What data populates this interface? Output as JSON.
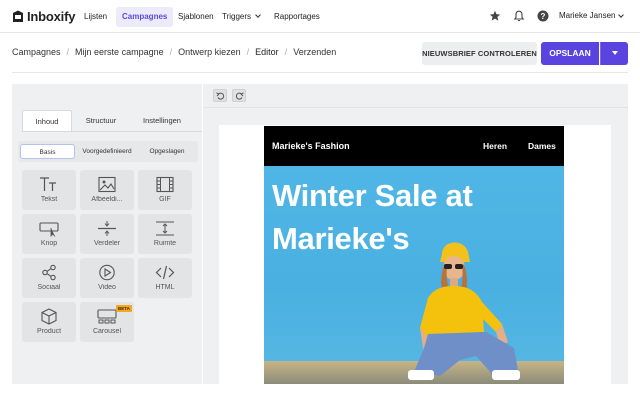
{
  "app": {
    "name": "Inboxify"
  },
  "nav": {
    "items": [
      {
        "label": "Lijsten"
      },
      {
        "label": "Campagnes",
        "active": true
      },
      {
        "label": "Sjablonen"
      },
      {
        "label": "Triggers",
        "has_dropdown": true
      },
      {
        "label": "Rapportages"
      }
    ],
    "icons": [
      "star-icon",
      "bell-icon",
      "help-icon"
    ],
    "user": "Marieke Jansen"
  },
  "breadcrumb": [
    "Campagnes",
    "Mijn eerste campagne",
    "Ontwerp kiezen",
    "Editor",
    "Verzenden"
  ],
  "actions": {
    "check_label": "NIEUWSBRIEF CONTROLEREN",
    "save_label": "OPSLAAN"
  },
  "panel": {
    "tabs": [
      "Inhoud",
      "Structuur",
      "Instellingen"
    ],
    "active_tab": "Inhoud",
    "subtabs": [
      "Basis",
      "Voorgedefinieerd",
      "Opgeslagen"
    ],
    "active_subtab": "Basis",
    "blocks": [
      {
        "label": "Tekst",
        "icon": "text-icon"
      },
      {
        "label": "Afbeeldi...",
        "icon": "image-icon"
      },
      {
        "label": "GIF",
        "icon": "gif-film-icon"
      },
      {
        "label": "Knop",
        "icon": "button-icon"
      },
      {
        "label": "Verdeler",
        "icon": "divider-icon"
      },
      {
        "label": "Ruimte",
        "icon": "spacer-icon"
      },
      {
        "label": "Sociaal",
        "icon": "share-icon"
      },
      {
        "label": "Video",
        "icon": "play-icon"
      },
      {
        "label": "HTML",
        "icon": "code-icon"
      },
      {
        "label": "Product",
        "icon": "box-icon"
      },
      {
        "label": "Carousel",
        "icon": "carousel-icon",
        "badge": "BETA"
      }
    ]
  },
  "email": {
    "brand": "Marieke's Fashion",
    "nav": [
      "Heren",
      "Dames"
    ],
    "hero_title": "Winter Sale at Marieke's",
    "colors": {
      "header_bg": "#000000",
      "hero_bg": "#4fb6e6"
    }
  },
  "colors": {
    "accent": "#5b43e0",
    "active_nav_bg": "#ecebfb"
  }
}
